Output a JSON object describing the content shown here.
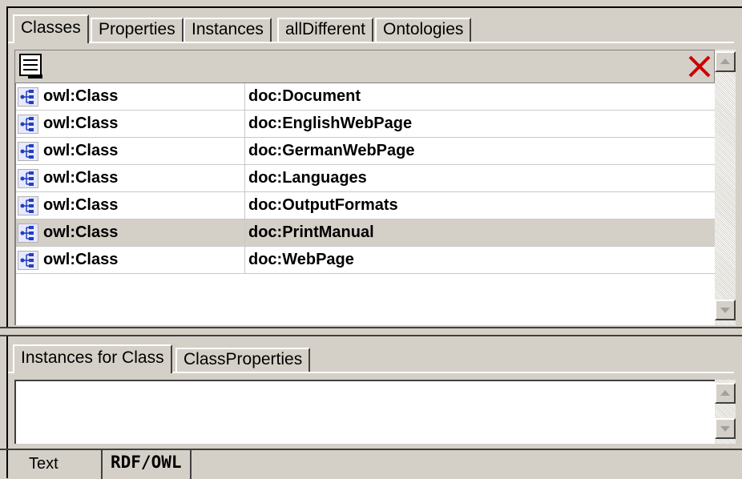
{
  "top_tabs": [
    "Classes",
    "Properties",
    "Instances",
    "allDifferent",
    "Ontologies"
  ],
  "active_top_tab": "Classes",
  "toolbar": {
    "list_icon": "list-icon",
    "delete_icon": "delete-x-icon",
    "delete_color": "#cc0000"
  },
  "rows": [
    {
      "type": "owl:Class",
      "name": "doc:Document"
    },
    {
      "type": "owl:Class",
      "name": "doc:EnglishWebPage"
    },
    {
      "type": "owl:Class",
      "name": "doc:GermanWebPage"
    },
    {
      "type": "owl:Class",
      "name": "doc:Languages"
    },
    {
      "type": "owl:Class",
      "name": "doc:OutputFormats"
    },
    {
      "type": "owl:Class",
      "name": "doc:PrintManual"
    },
    {
      "type": "owl:Class",
      "name": "doc:WebPage"
    }
  ],
  "selected_row": "doc:PrintManual",
  "bottom_tabs": [
    "Instances for Class",
    "ClassProperties"
  ],
  "active_bottom_tab": "Instances for Class",
  "status_tabs": [
    "Text",
    "RDF/OWL"
  ],
  "active_status_tab": "RDF/OWL"
}
